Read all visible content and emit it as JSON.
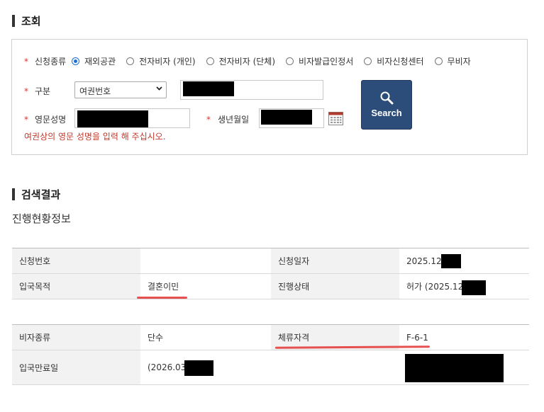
{
  "query_section": {
    "title": "조회",
    "application_type_label": "신청종류",
    "application_types": [
      "재외공관",
      "전자비자 (개인)",
      "전자비자 (단체)",
      "비자발급인정서",
      "비자신청센터",
      "무비자"
    ],
    "selected_application_type": "재외공관",
    "division_label": "구분",
    "division_select_value": "여권번호",
    "english_name_label": "영문성명",
    "birthdate_label": "생년월일",
    "hint": "여권상의 영문 성명을 입력 해 주십시오.",
    "search_button_label": "Search"
  },
  "results_section": {
    "title": "검색결과",
    "subtitle": "진행현황정보",
    "table1": [
      {
        "label1": "신청번호",
        "value1": "",
        "label2": "신청일자",
        "value2": "2025.12."
      },
      {
        "label1": "입국목적",
        "value1": "결혼이민",
        "label2": "진행상태",
        "value2": "허가 (2025.12."
      }
    ],
    "table2": [
      {
        "label1": "비자종류",
        "value1": "단수",
        "label2": "체류자격",
        "value2": "F-6-1"
      },
      {
        "label1": "입국만료일",
        "value1": "(2026.03",
        "label2": "",
        "value2": ""
      }
    ]
  },
  "colors": {
    "required_mark": "#e03030",
    "hint_text": "#c0392b",
    "search_button": "#2c4d7a",
    "radio_selected": "#1a6fd8",
    "highlight_underline": "#e55050",
    "redaction": "#000000"
  },
  "icons": {
    "search_button_icon": "magnifier-icon",
    "birthdate_picker_icon": "calendar-icon"
  }
}
